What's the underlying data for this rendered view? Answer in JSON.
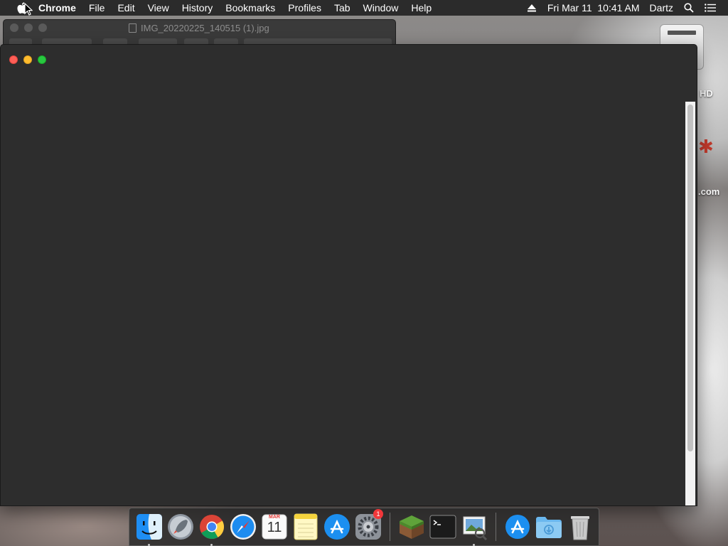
{
  "menubar": {
    "app_name": "Chrome",
    "menus": [
      "File",
      "Edit",
      "View",
      "History",
      "Bookmarks",
      "Profiles",
      "Tab",
      "Window",
      "Help"
    ],
    "datetime": "Fri Mar 11  10:41 AM",
    "user": "Dartz"
  },
  "background_window": {
    "title": "IMG_20220225_140515 (1).jpg"
  },
  "desktop": {
    "label_1": "HD",
    "label_2": ".com"
  },
  "dock": {
    "items": [
      {
        "name": "Finder",
        "running": true
      },
      {
        "name": "Launchpad",
        "running": false
      },
      {
        "name": "Google Chrome",
        "running": true
      },
      {
        "name": "Safari",
        "running": false
      },
      {
        "name": "Calendar",
        "running": false,
        "month": "MAR",
        "day": "11"
      },
      {
        "name": "Notes",
        "running": false
      },
      {
        "name": "App Store",
        "running": false
      },
      {
        "name": "System Preferences",
        "running": false,
        "badge": "1"
      },
      {
        "name": "Minecraft",
        "running": false
      },
      {
        "name": "Terminal",
        "running": false
      },
      {
        "name": "Preview",
        "running": true
      },
      {
        "name": "Applications",
        "running": false
      },
      {
        "name": "Downloads",
        "running": false
      },
      {
        "name": "Trash",
        "running": false
      }
    ]
  },
  "colors": {
    "menubar": "#2b2b2b",
    "window_bg": "#2d2d2d",
    "close": "#fe5f57",
    "minimize": "#febc2e",
    "zoom": "#28c840"
  }
}
